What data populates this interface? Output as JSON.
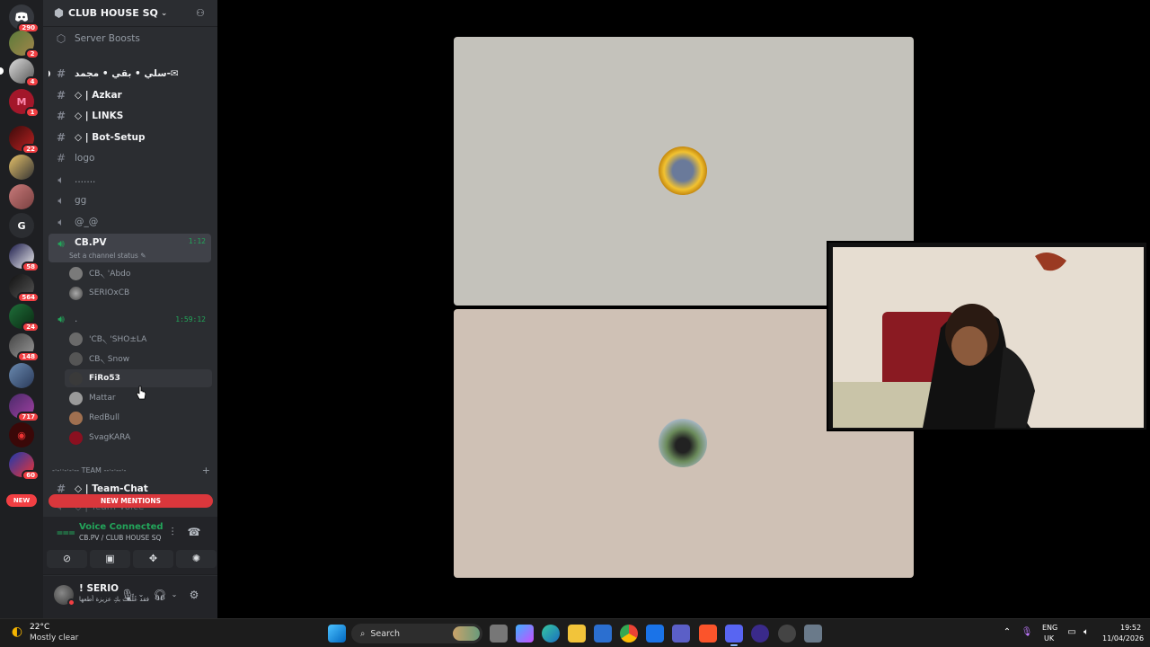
{
  "server": {
    "name": "CLUB HOUSE SQ",
    "boosts_label": "Server Boosts"
  },
  "rail": {
    "badges": [
      "290",
      "2",
      "4",
      "1",
      "22",
      "58",
      "564",
      "24",
      "148",
      "717",
      "60"
    ],
    "letter_server": "G",
    "new_label": "NEW"
  },
  "channels": [
    {
      "type": "text",
      "label": "سلي • بقي • مجمد-✉",
      "bold": true
    },
    {
      "type": "text",
      "label": "◇ | Azkar",
      "bold": true
    },
    {
      "type": "text",
      "label": "◇ | LINKS",
      "bold": true
    },
    {
      "type": "text",
      "label": "◇ | Bot-Setup",
      "bold": true
    },
    {
      "type": "text",
      "label": "logo",
      "bold": false
    },
    {
      "type": "voice",
      "label": ".......",
      "bold": false
    },
    {
      "type": "voice",
      "label": "gg",
      "bold": false
    },
    {
      "type": "voice",
      "label": "@_@",
      "bold": false
    }
  ],
  "active_voice": {
    "name": "CB.PV",
    "timer": "1:12",
    "status_placeholder": "Set a channel status",
    "members": [
      "CB৲ 'Abdo",
      "SERIOxCB"
    ]
  },
  "second_voice": {
    "name": ".",
    "timer": "1:59:12",
    "members": [
      "'CB৲ 'SHO±LA",
      "CB৲ Snow",
      "FiRo53",
      "Mattar",
      "RedBull",
      "SvagKARA"
    ]
  },
  "category": {
    "label": "-·-··-·-·-- TEAM --·-·--·-"
  },
  "more_channels": [
    {
      "label": "◇ | Team-Chat"
    },
    {
      "label": "◇ | Team Voice"
    }
  ],
  "mentions_label": "NEW MENTIONS",
  "voice_panel": {
    "status": "Voice Connected",
    "location": "CB.PV / CLUB HOUSE SQ"
  },
  "user": {
    "name": "! SERIO",
    "status": "فقد عُلِّقتُ بكِ عزيزة أطعها"
  },
  "taskbar": {
    "weather_temp": "22°C",
    "weather_desc": "Mostly clear",
    "search": "Search",
    "lang_1": "ENG",
    "lang_2": "UK",
    "time": "19:52",
    "date": "11/04/2026"
  },
  "colors": {
    "accent_green": "#23a55a",
    "danger_red": "#da373c",
    "sidebar_bg": "#2b2d31",
    "rail_bg": "#1e1f22",
    "stage_bg": "#000000"
  }
}
